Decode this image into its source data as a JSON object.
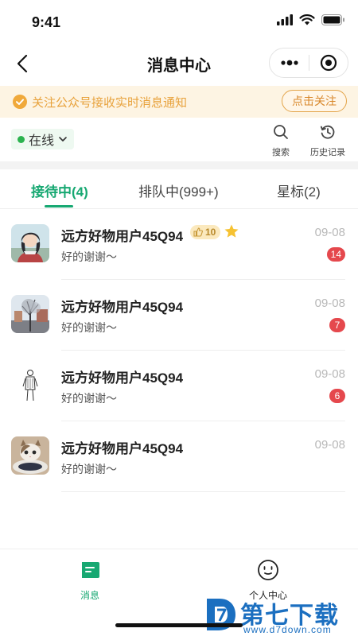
{
  "status_bar": {
    "time": "9:41"
  },
  "nav": {
    "title": "消息中心"
  },
  "notice": {
    "text": "关注公众号接收实时消息通知",
    "button": "点击关注"
  },
  "status": {
    "label": "在线"
  },
  "tools": {
    "search": "搜索",
    "history": "历史记录"
  },
  "tabs": [
    {
      "label": "接待中(4)",
      "active": true
    },
    {
      "label": "排队中(999+)",
      "active": false
    },
    {
      "label": "星标(2)",
      "active": false
    }
  ],
  "messages": [
    {
      "name": "远方好物用户45Q94",
      "preview": "好的谢谢～",
      "date": "09-08",
      "unread": "14",
      "level": "10",
      "starred": true,
      "avatar": "anime-girl-avatar"
    },
    {
      "name": "远方好物用户45Q94",
      "preview": "好的谢谢～",
      "date": "09-08",
      "unread": "7",
      "avatar": "winter-tree-avatar"
    },
    {
      "name": "远方好物用户45Q94",
      "preview": "好的谢谢～",
      "date": "09-08",
      "unread": "6",
      "avatar": "sketch-figure-avatar"
    },
    {
      "name": "远方好物用户45Q94",
      "preview": "好的谢谢～",
      "date": "09-08",
      "avatar": "cat-avatar"
    }
  ],
  "bottom_tabs": [
    {
      "label": "消息",
      "active": true,
      "icon": "message-icon"
    },
    {
      "label": "个人中心",
      "active": false,
      "icon": "profile-icon"
    }
  ],
  "watermark": {
    "title": "第七下载站",
    "url": "www.d7down.com"
  },
  "colors": {
    "accent": "#17a872",
    "notice_bg": "#fdf4e3",
    "notice_text": "#e8a23c",
    "unread": "#e5484d"
  }
}
